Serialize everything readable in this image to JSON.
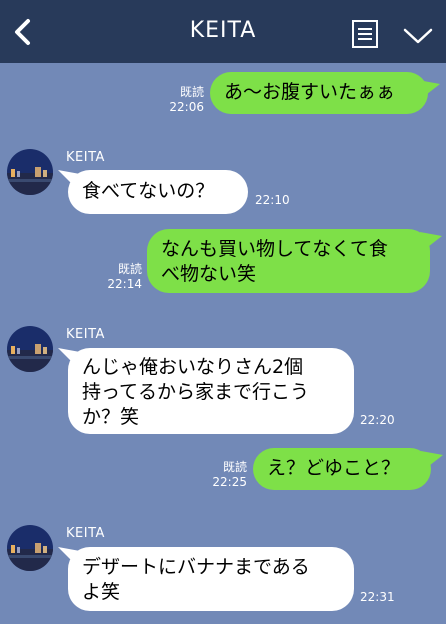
{
  "header": {
    "title": "KEITA",
    "back_icon": "chevron-left-icon",
    "menu_icon": "note-icon",
    "expand_icon": "chevron-down-icon"
  },
  "colors": {
    "background": "#7289b7",
    "header": "#283a5a",
    "outgoing": "#7ee048",
    "incoming": "#ffffff"
  },
  "messages": [
    {
      "side": "out",
      "lines": [
        "あ〜お腹すいたぁぁ"
      ],
      "read": "既読",
      "time": "22:06"
    },
    {
      "side": "in",
      "sender": "KEITA",
      "lines": [
        "食べてないの？"
      ],
      "time": "22:10"
    },
    {
      "side": "out",
      "lines": [
        "なんも買い物してなくて食",
        "べ物ない笑"
      ],
      "read": "既読",
      "time": "22:14"
    },
    {
      "side": "in",
      "sender": "KEITA",
      "lines": [
        "んじゃ俺おいなりさん2個",
        "持ってるから家まで行こう",
        "か？笑"
      ],
      "time": "22:20"
    },
    {
      "side": "out",
      "lines": [
        "え？どゆこと？"
      ],
      "read": "既読",
      "time": "22:25"
    },
    {
      "side": "in",
      "sender": "KEITA",
      "lines": [
        "デザートにバナナまである",
        "よ笑"
      ],
      "time": "22:31"
    }
  ]
}
